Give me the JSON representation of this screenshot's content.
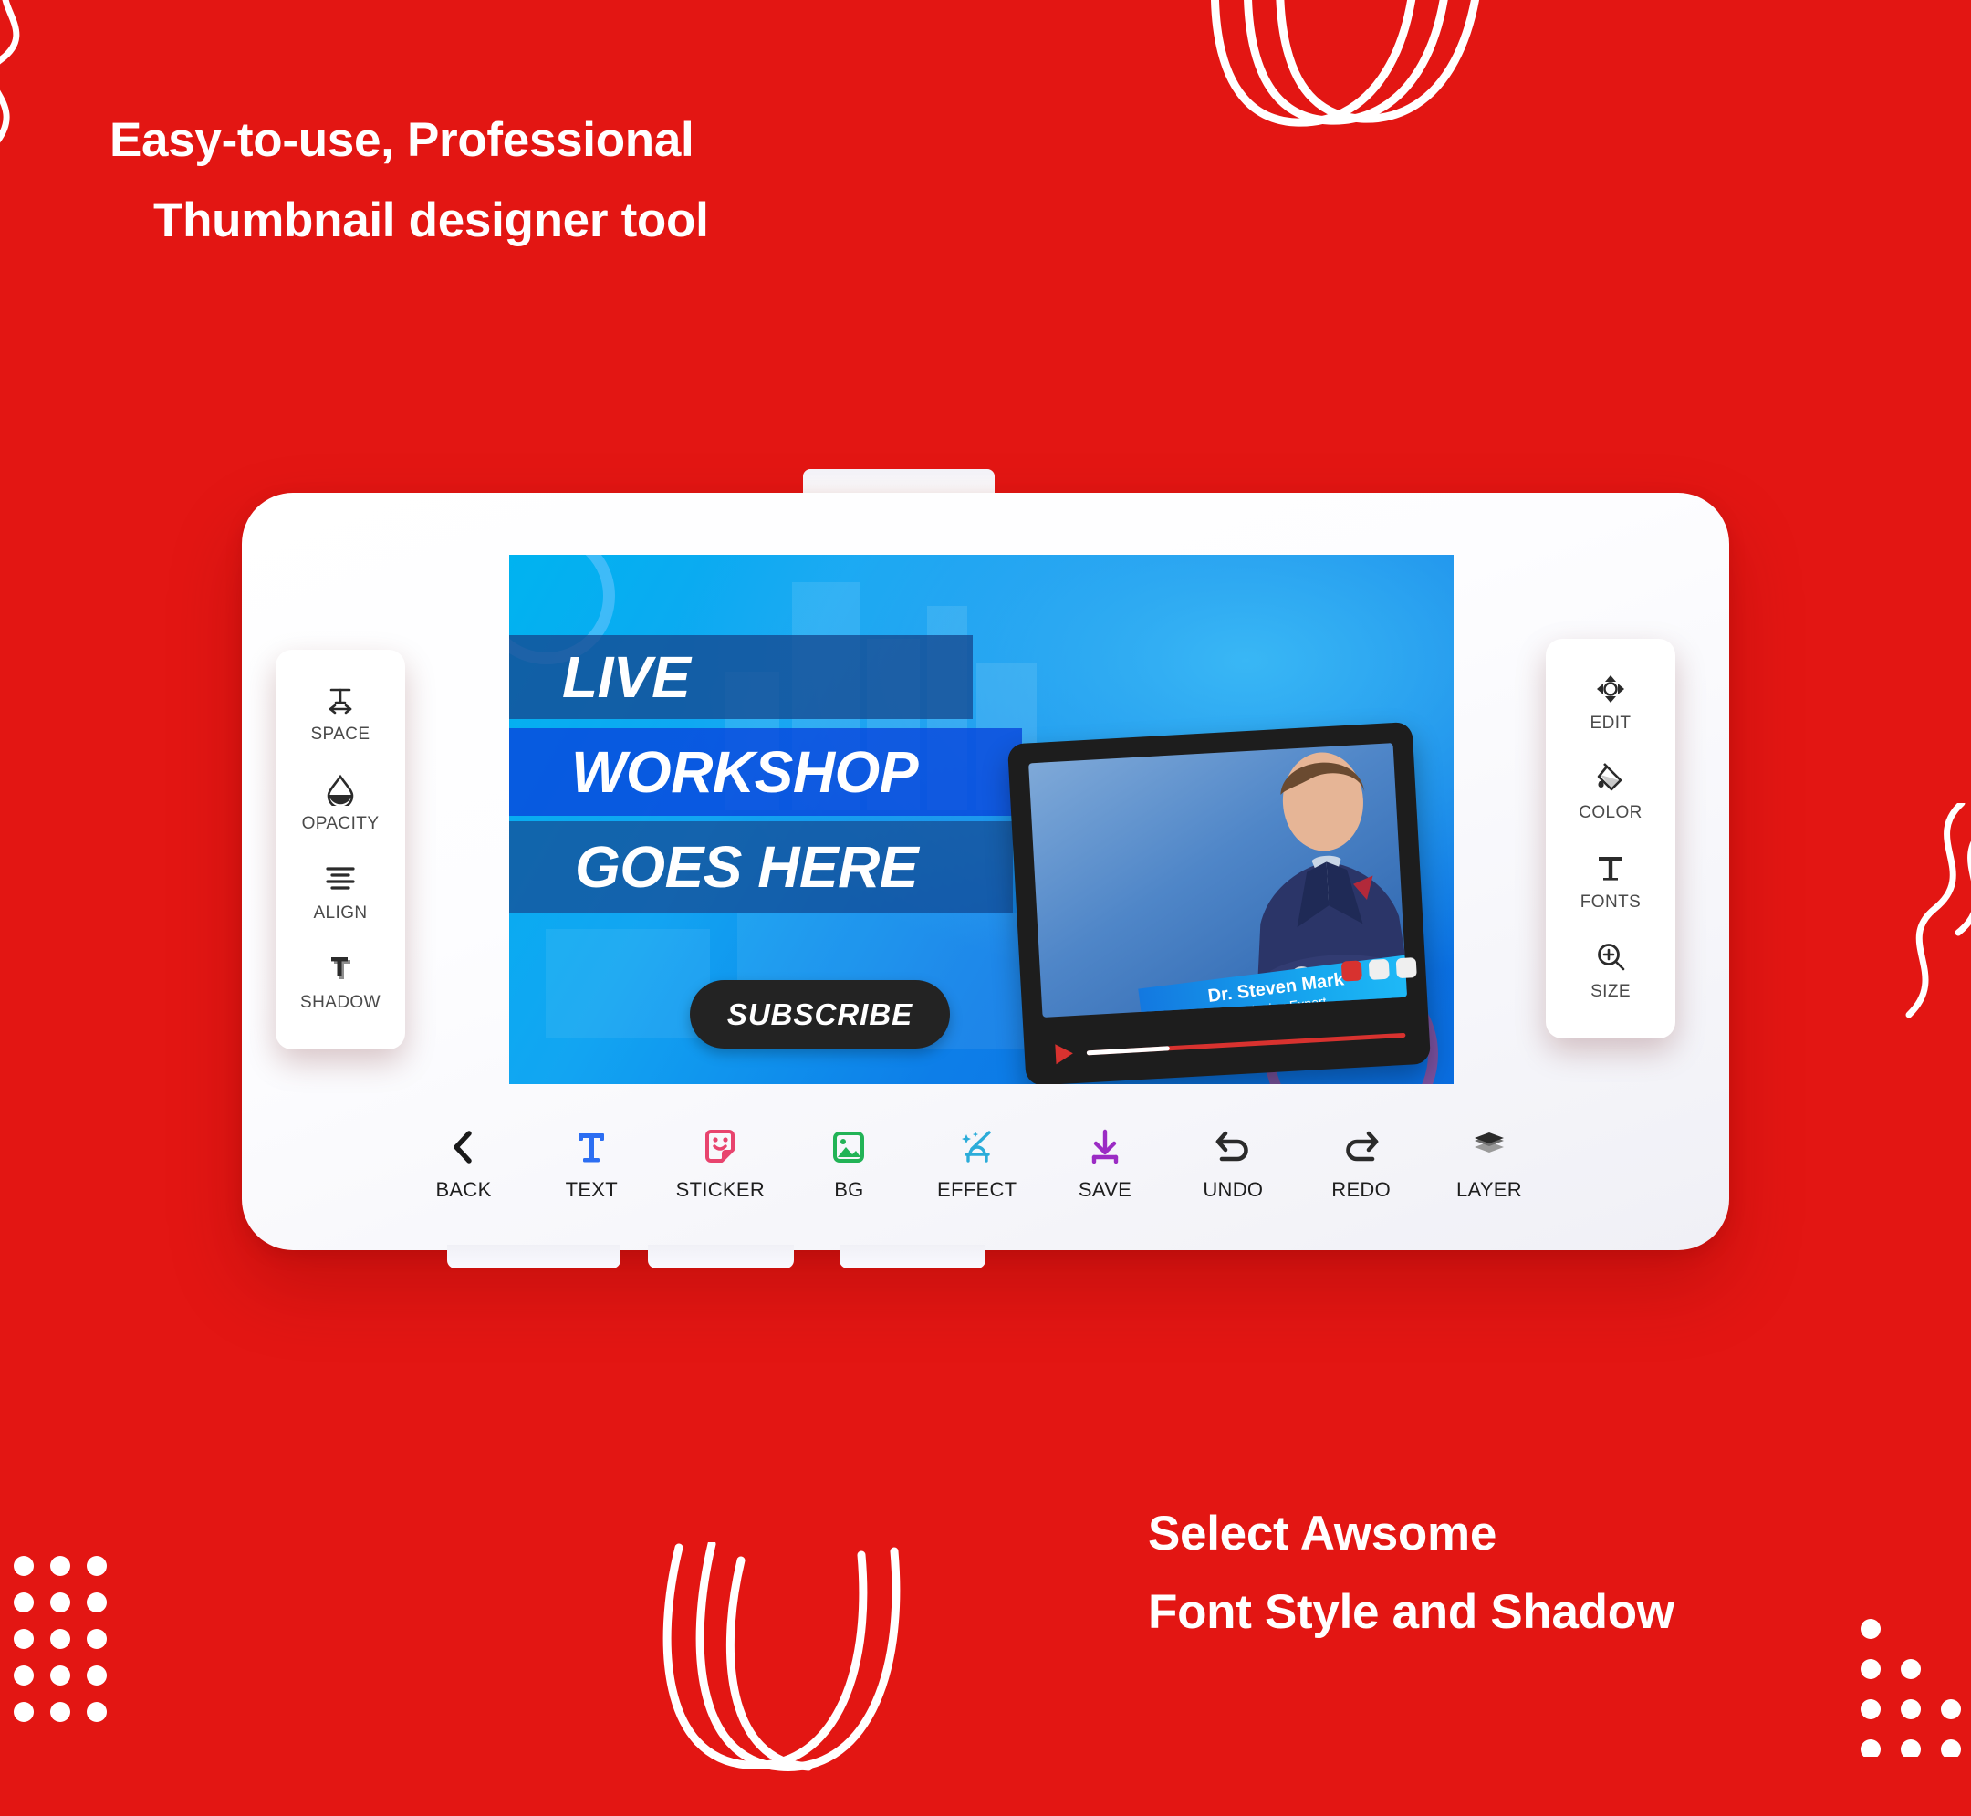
{
  "theme": {
    "background_red": "#E31613",
    "accent_blue": "#0d7ee8",
    "dark": "#232323"
  },
  "headlines": {
    "top_line_1": "Easy-to-use, Professional",
    "top_line_2": "Thumbnail designer tool",
    "bottom_line_1": "Select Awsome",
    "bottom_line_2": "Font Style and Shadow"
  },
  "canvas": {
    "band_1": "LIVE",
    "band_2": "WORKSHOP",
    "band_3": "GOES HERE",
    "subscribe_label": "SUBSCRIBE",
    "presenter_name": "Dr. Steven Mark",
    "presenter_role": "Marketing Expert"
  },
  "left_panel": {
    "items": [
      {
        "label": "SPACE",
        "icon": "text-spacing-icon"
      },
      {
        "label": "OPACITY",
        "icon": "opacity-droplet-icon"
      },
      {
        "label": "ALIGN",
        "icon": "align-center-icon"
      },
      {
        "label": "SHADOW",
        "icon": "text-shadow-icon"
      }
    ]
  },
  "right_panel": {
    "items": [
      {
        "label": "EDIT",
        "icon": "move-arrows-icon"
      },
      {
        "label": "COLOR",
        "icon": "paint-bucket-icon"
      },
      {
        "label": "FONTS",
        "icon": "text-t-icon"
      },
      {
        "label": "SIZE",
        "icon": "zoom-in-icon"
      }
    ]
  },
  "bottom_toolbar": {
    "items": [
      {
        "label": "BACK",
        "icon": "chevron-left-icon",
        "color": "#1a1a1a"
      },
      {
        "label": "TEXT",
        "icon": "text-t-icon",
        "color": "#2c6ef2"
      },
      {
        "label": "STICKER",
        "icon": "sticker-icon",
        "color": "#e8446e"
      },
      {
        "label": "BG",
        "icon": "image-icon",
        "color": "#22b356"
      },
      {
        "label": "EFFECT",
        "icon": "magic-wand-icon",
        "color": "#2bacd9"
      },
      {
        "label": "SAVE",
        "icon": "download-icon",
        "color": "#9b2cc4"
      },
      {
        "label": "UNDO",
        "icon": "undo-arrow-icon",
        "color": "#2b2b2b"
      },
      {
        "label": "REDO",
        "icon": "redo-arrow-icon",
        "color": "#2b2b2b"
      },
      {
        "label": "LAYER",
        "icon": "layers-icon",
        "color": "#2b2b2b"
      }
    ]
  }
}
